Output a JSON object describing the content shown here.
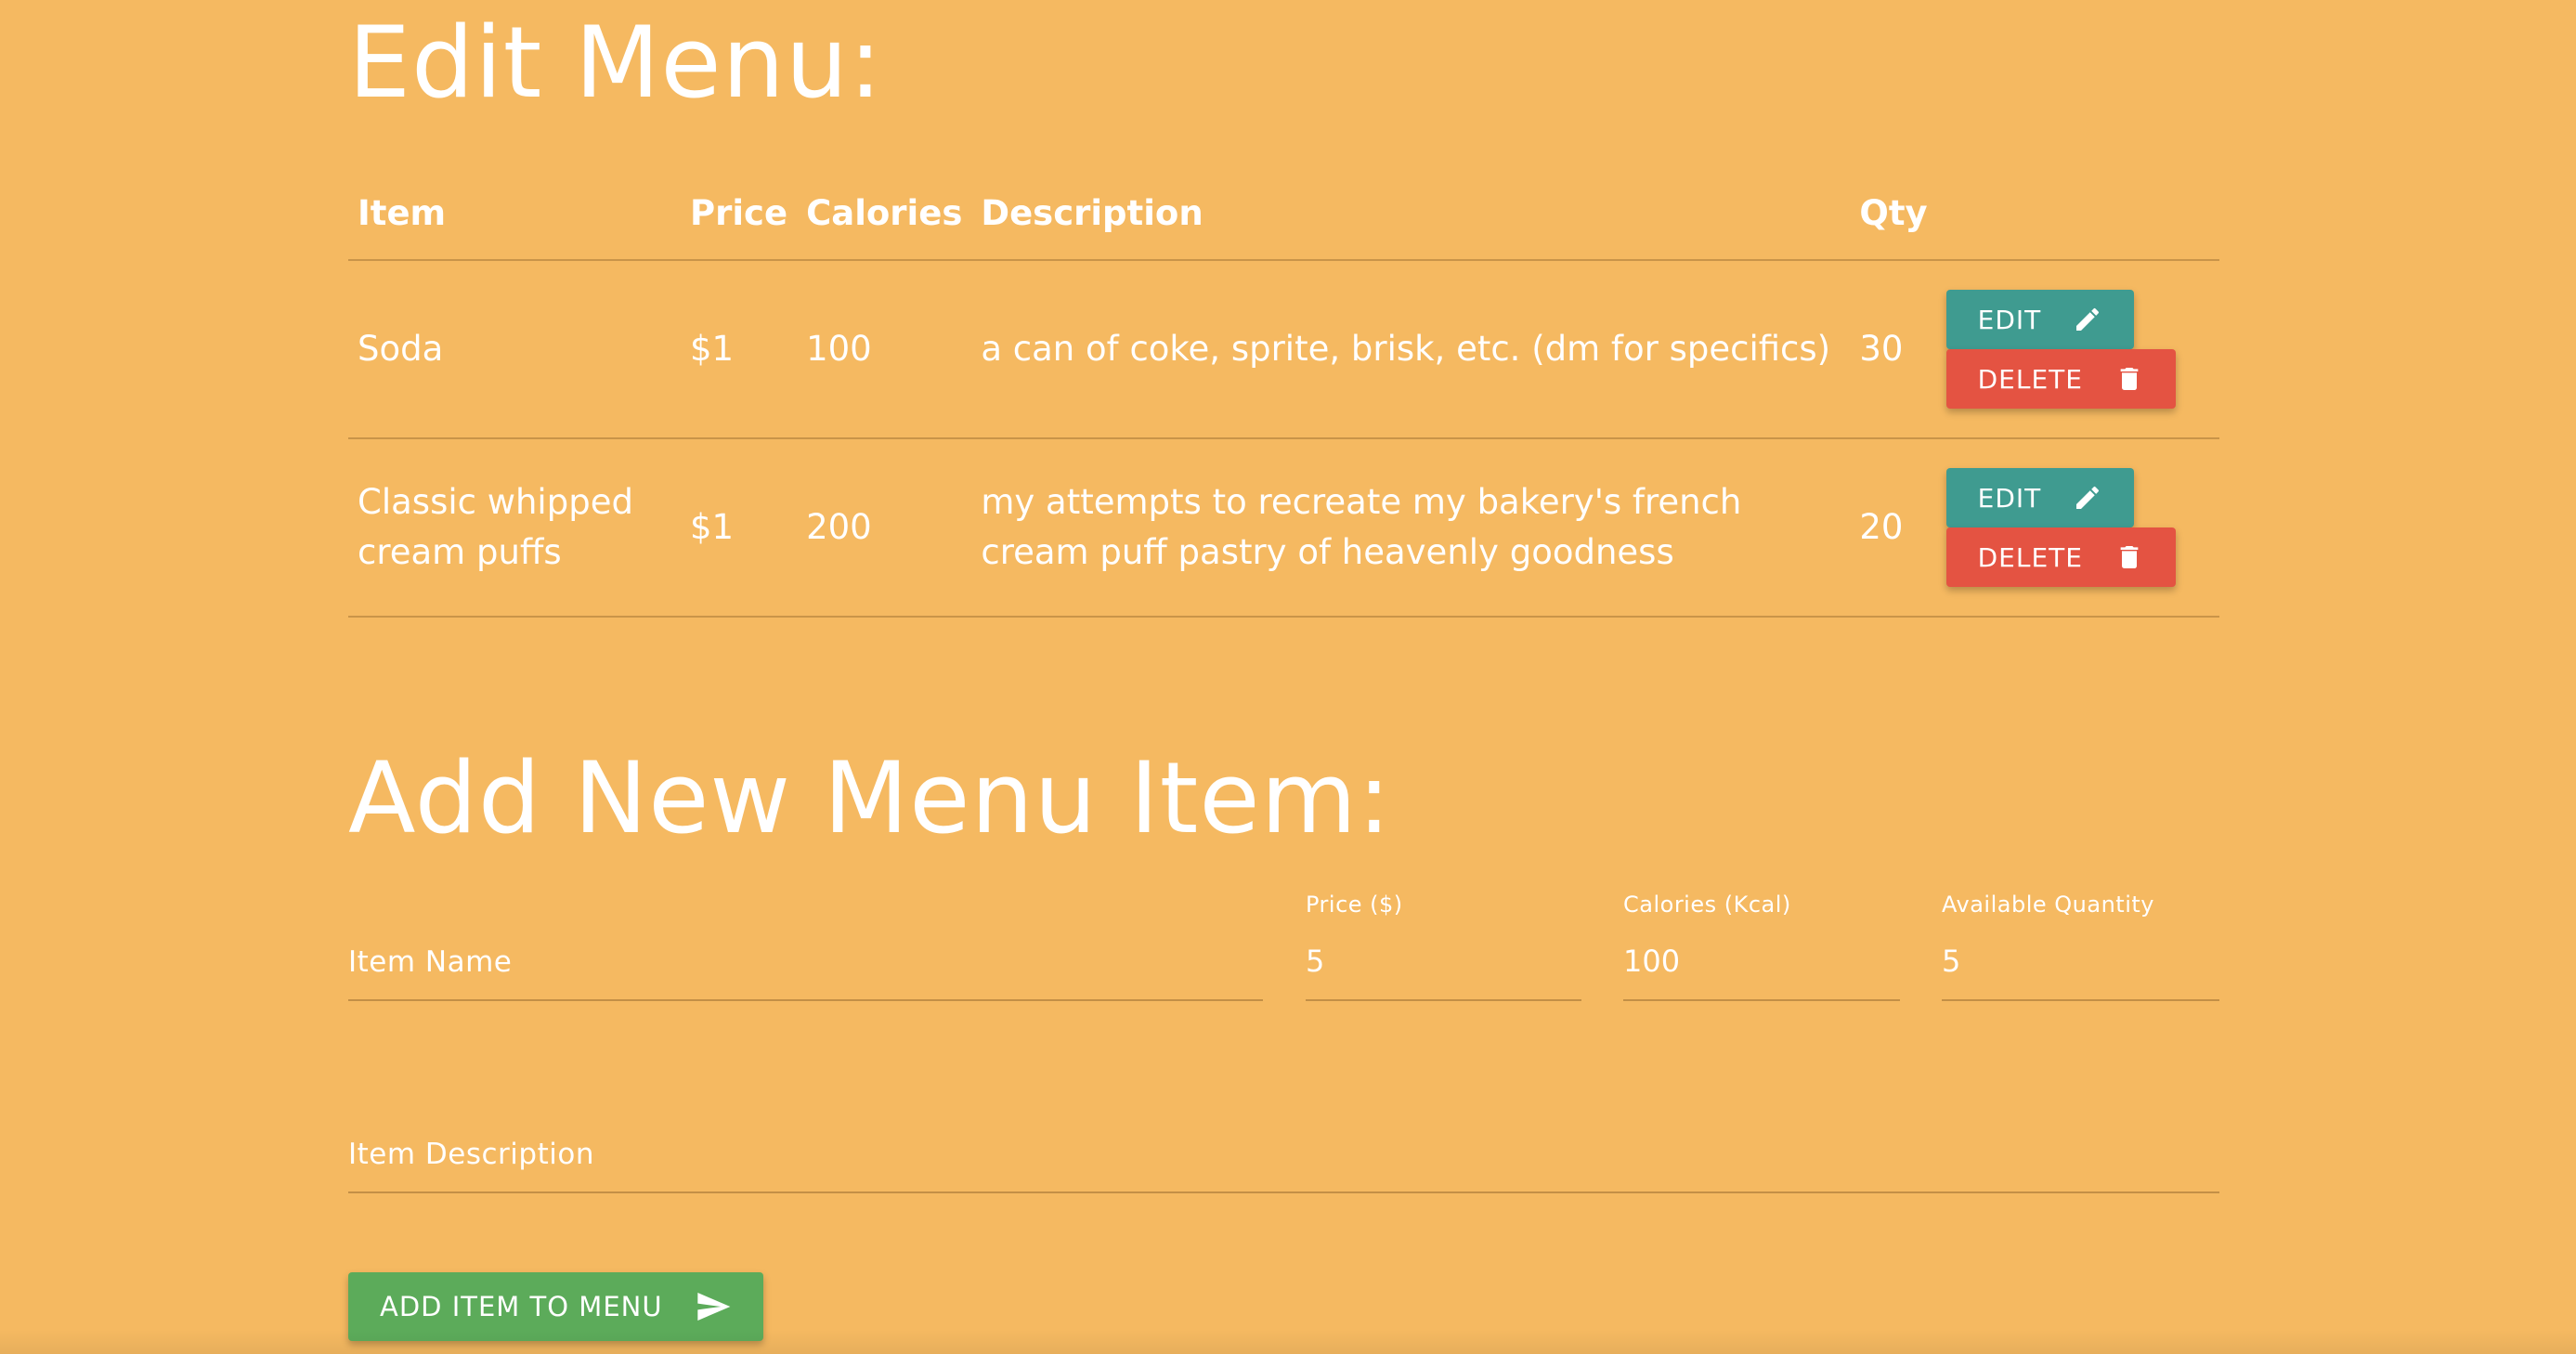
{
  "edit_section": {
    "title": "Edit Menu:",
    "columns": [
      "Item",
      "Price",
      "Calories",
      "Description",
      "Qty"
    ],
    "rows": [
      {
        "item": "Soda",
        "price": "$1",
        "calories": "100",
        "description": "a can of coke, sprite, brisk, etc. (dm for specifics)",
        "qty": "30"
      },
      {
        "item": "Classic whipped cream puffs",
        "price": "$1",
        "calories": "200",
        "description": "my attempts to recreate my bakery's french cream puff pastry of heavenly goodness",
        "qty": "20"
      }
    ],
    "edit_label": "EDIT",
    "delete_label": "DELETE"
  },
  "add_section": {
    "title": "Add New Menu Item:",
    "item_name": {
      "label": "Item Name",
      "value": ""
    },
    "price": {
      "label": "Price ($)",
      "value": "5"
    },
    "calories": {
      "label": "Calories (Kcal)",
      "value": "100"
    },
    "quantity": {
      "label": "Available Quantity",
      "value": "5"
    },
    "description": {
      "label": "Item Description",
      "value": ""
    },
    "submit_label": "ADD ITEM TO MENU"
  },
  "colors": {
    "background": "#f5b961",
    "edit_button": "#3f9b90",
    "delete_button": "#e45342",
    "add_button": "#5cab5a"
  },
  "icons": {
    "edit": "pencil-icon",
    "delete": "trash-icon",
    "submit": "send-icon"
  }
}
